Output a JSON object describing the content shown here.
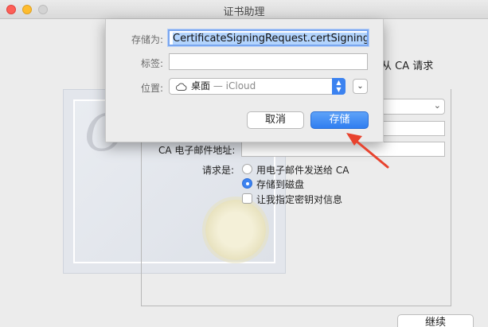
{
  "window": {
    "title": "证书助理"
  },
  "main": {
    "ca_request_text": "从 CA 请求",
    "ca_email_label": "CA 电子邮件地址:",
    "request_label": "请求是:",
    "radio_email": "用电子邮件发送给 CA",
    "radio_disk": "存储到磁盘",
    "checkbox_keys": "让我指定密钥对信息",
    "continue_label": "继续"
  },
  "save_sheet": {
    "save_as_label": "存储为:",
    "save_as_value": "CertificateSigningRequest.certSigningRe",
    "tags_label": "标签:",
    "location_label": "位置:",
    "location_value": "桌面",
    "location_sub": "— iCloud",
    "cancel_label": "取消",
    "save_label": "存储"
  },
  "colors": {
    "accent": "#3b82f0",
    "arrow": "#e8432e"
  }
}
